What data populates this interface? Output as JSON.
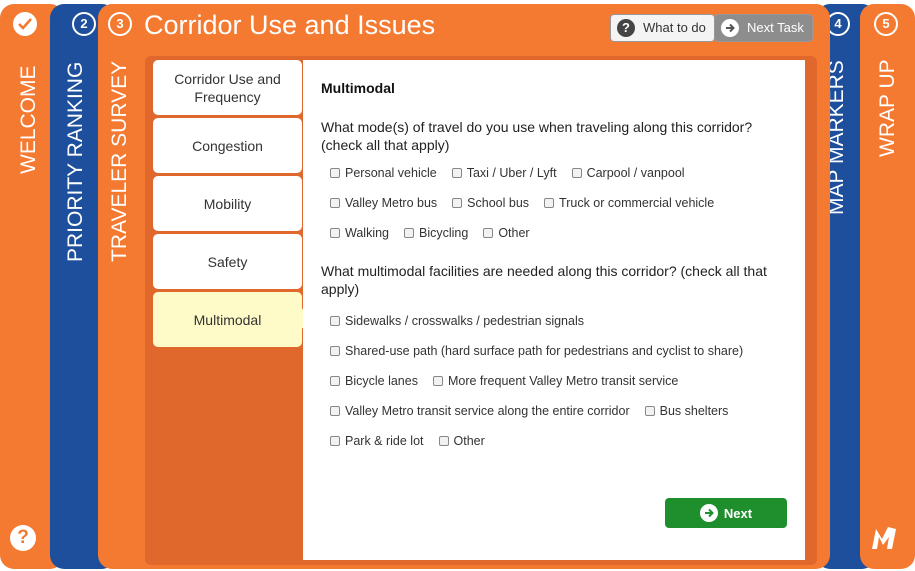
{
  "tabs": {
    "welcome": {
      "label": "WELCOME"
    },
    "priority": {
      "number": "2",
      "label": "PRIORITY RANKING"
    },
    "survey": {
      "number": "3",
      "label": "TRAVELER SURVEY"
    },
    "map": {
      "number": "4",
      "label": "MAP MARKERS"
    },
    "wrap": {
      "number": "5",
      "label": "WRAP UP"
    }
  },
  "header": {
    "title": "Corridor Use and Issues",
    "what_to_do": "What to do",
    "next_task": "Next Task"
  },
  "subtabs": [
    {
      "label": "Corridor Use and Frequency"
    },
    {
      "label": "Congestion"
    },
    {
      "label": "Mobility"
    },
    {
      "label": "Safety"
    },
    {
      "label": "Multimodal"
    }
  ],
  "panel": {
    "heading": "Multimodal",
    "q1": "What mode(s) of travel do you use when traveling along this corridor? (check all that apply)",
    "q1_options": [
      [
        "Personal vehicle",
        "Taxi / Uber / Lyft",
        "Carpool / vanpool"
      ],
      [
        "Valley Metro bus",
        "School bus",
        "Truck or commercial vehicle"
      ],
      [
        "Walking",
        "Bicycling",
        "Other"
      ]
    ],
    "q2": "What multimodal facilities are needed along this corridor? (check all that apply)",
    "q2_options": [
      [
        "Sidewalks / crosswalks / pedestrian signals"
      ],
      [
        "Shared-use path (hard surface path for pedestrians and cyclist to share)"
      ],
      [
        "Bicycle lanes",
        "More frequent Valley Metro transit service"
      ],
      [
        "Valley Metro transit service along the entire corridor",
        "Bus shelters"
      ],
      [
        "Park & ride lot",
        "Other"
      ]
    ],
    "next": "Next"
  },
  "colors": {
    "orange": "#f47a32",
    "blue": "#1d4f9c",
    "green": "#1f8f2d",
    "active_tab": "#fffbc8"
  }
}
